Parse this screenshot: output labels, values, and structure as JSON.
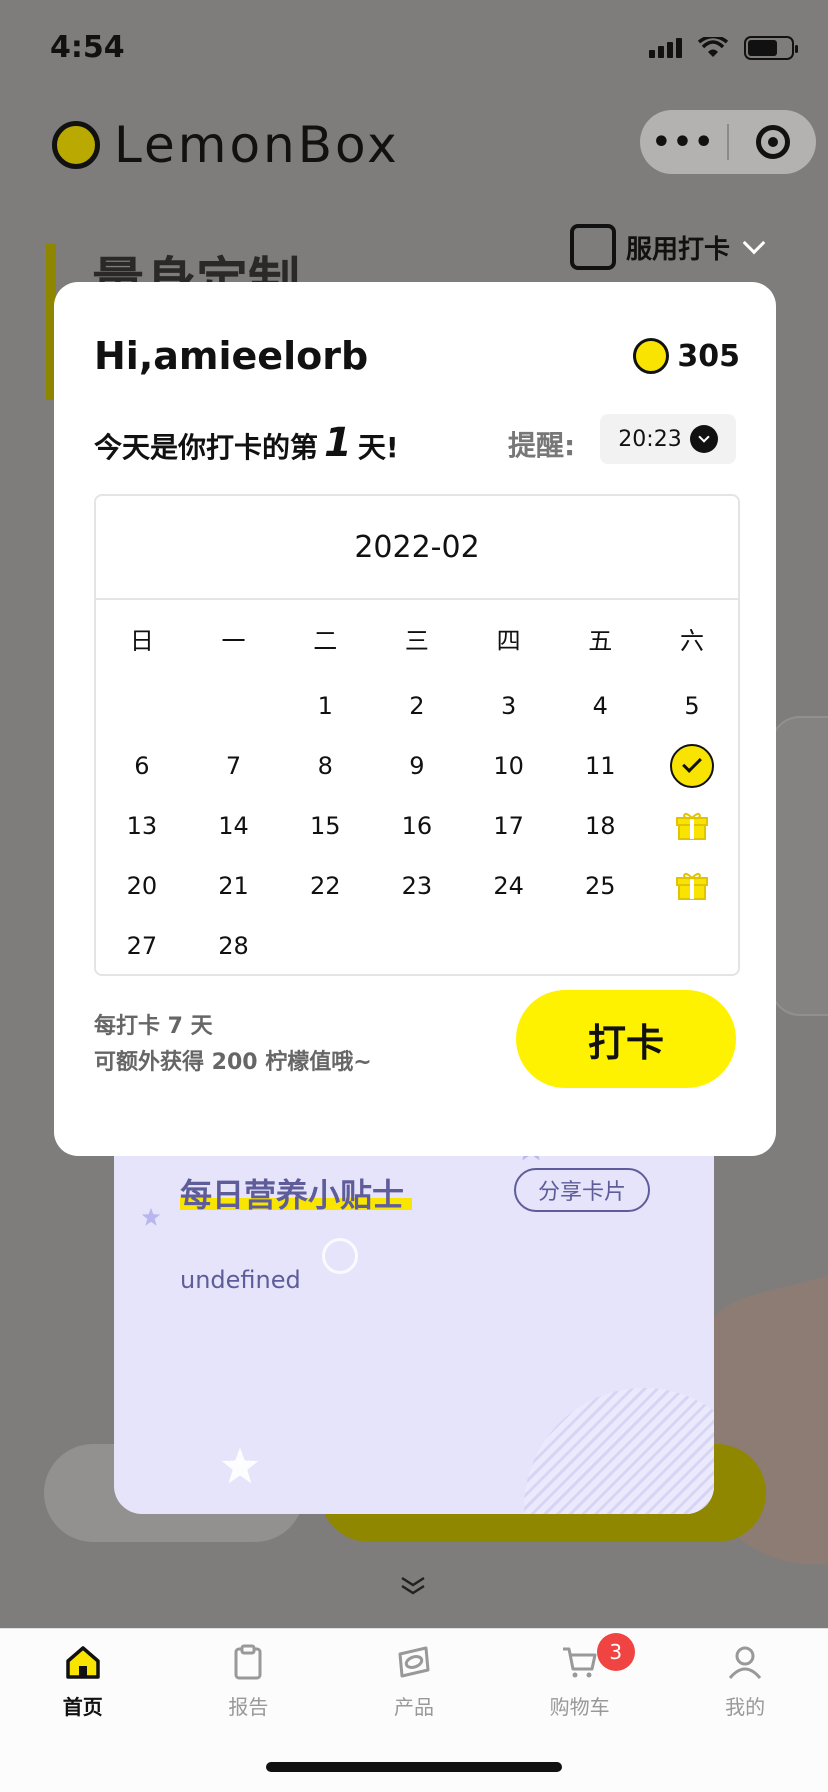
{
  "status_bar": {
    "time": "4:54"
  },
  "app": {
    "logo_text": "LemonBox"
  },
  "background": {
    "heading": "量身定制",
    "checkin_entry": "服用打卡"
  },
  "modal": {
    "greeting": "Hi,amieelorb",
    "points": "305",
    "today_prefix": "今天是你打卡的第",
    "today_day": "1",
    "today_suffix": "天!",
    "remind_label": "提醒:",
    "remind_time": "20:23",
    "calendar": {
      "month": "2022-02",
      "weekdays": [
        "日",
        "一",
        "二",
        "三",
        "四",
        "五",
        "六"
      ],
      "weeks": [
        [
          "",
          "",
          "1",
          "2",
          "3",
          "4",
          "5"
        ],
        [
          "6",
          "7",
          "8",
          "9",
          "10",
          "11",
          "check"
        ],
        [
          "13",
          "14",
          "15",
          "16",
          "17",
          "18",
          "gift"
        ],
        [
          "20",
          "21",
          "22",
          "23",
          "24",
          "25",
          "gift"
        ],
        [
          "27",
          "28",
          "",
          "",
          "",
          "",
          ""
        ]
      ]
    },
    "rule_line1": "每打卡 7 天",
    "rule_line2": "可额外获得 200 柠檬值哦~",
    "punch_button": "打卡"
  },
  "tip_card": {
    "title": "每日营养小贴士",
    "share_button": "分享卡片",
    "body": "undefined"
  },
  "tabbar": {
    "items": [
      {
        "label": "首页",
        "icon": "home-icon",
        "active": true
      },
      {
        "label": "报告",
        "icon": "clipboard-icon",
        "active": false
      },
      {
        "label": "产品",
        "icon": "product-icon",
        "active": false
      },
      {
        "label": "购物车",
        "icon": "cart-icon",
        "active": false,
        "badge": "3"
      },
      {
        "label": "我的",
        "icon": "user-icon",
        "active": false
      }
    ]
  },
  "colors": {
    "accent": "#fff200",
    "badge": "#f04442",
    "tip_bg": "#e5e4fb"
  }
}
